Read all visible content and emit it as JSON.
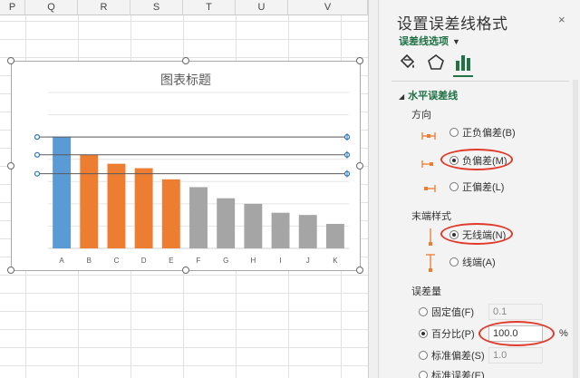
{
  "sheet": {
    "columns": [
      "P",
      "Q",
      "R",
      "S",
      "T",
      "U",
      "V"
    ]
  },
  "chart": {
    "title": "图表标题"
  },
  "chart_data": {
    "type": "bar",
    "title": "图表标题",
    "categories": [
      "A",
      "B",
      "C",
      "D",
      "E",
      "F",
      "G",
      "H",
      "I",
      "J",
      "K"
    ],
    "values": [
      100,
      84,
      76,
      72,
      62,
      55,
      45,
      40,
      32,
      30,
      22
    ],
    "bar_colors": [
      "#5b9bd5",
      "#ed7d31",
      "#ed7d31",
      "#ed7d31",
      "#ed7d31",
      "#a5a5a5",
      "#a5a5a5",
      "#a5a5a5",
      "#a5a5a5",
      "#a5a5a5",
      "#a5a5a5"
    ],
    "error_bar_lines": [
      {
        "series": "A",
        "value": 100
      },
      {
        "series": "B",
        "value": 84
      },
      {
        "series": "C",
        "value": 67
      }
    ],
    "ylim": [
      0,
      140
    ],
    "grid": true,
    "legend": "none"
  },
  "pane": {
    "title": "设置误差线格式",
    "close_icon": "×",
    "options_label": "误差线选项",
    "tabs": [
      "fill-line-icon",
      "effects-icon",
      "bar-chart-icon"
    ],
    "section_title": "水平误差线",
    "direction": {
      "label": "方向",
      "options": [
        {
          "label": "正负偏差(B)",
          "checked": false
        },
        {
          "label": "负偏差(M)",
          "checked": true
        },
        {
          "label": "正偏差(L)",
          "checked": false
        }
      ]
    },
    "end_style": {
      "label": "末端样式",
      "options": [
        {
          "label": "无线端(N)",
          "checked": true
        },
        {
          "label": "线端(A)",
          "checked": false
        }
      ]
    },
    "error_amount": {
      "label": "误差量",
      "options": [
        {
          "label": "固定值(F)",
          "checked": false,
          "value": "0.1"
        },
        {
          "label": "百分比(P)",
          "checked": true,
          "value": "100.0",
          "unit": "%"
        },
        {
          "label": "标准偏差(S)",
          "checked": false,
          "value": "1.0"
        },
        {
          "label": "标准误差(E)",
          "checked": false
        }
      ]
    },
    "accent_color": "#1e7145",
    "highlight_color": "#e03a2a"
  }
}
